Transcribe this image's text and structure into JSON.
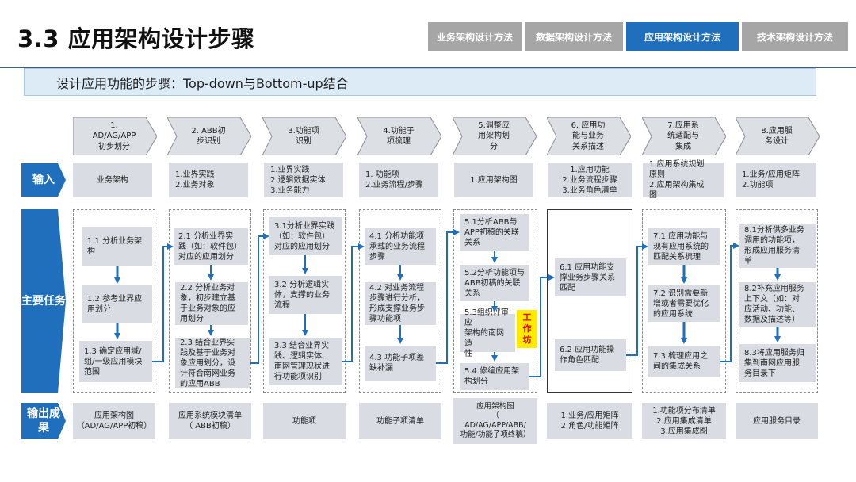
{
  "page_title": "3.3 应用架构设计步骤",
  "nav_tabs": [
    {
      "label": "业务架构设计方法",
      "active": false
    },
    {
      "label": "数据架构设计方法",
      "active": false
    },
    {
      "label": "应用架构设计方法",
      "active": true
    },
    {
      "label": "技术架构设计方法",
      "active": false
    }
  ],
  "subtitle": "设计应用功能的步骤：Top-down与Bottom-up结合",
  "row_labels": {
    "input": "输入",
    "tasks": "主要任务",
    "output": "输出成\n果"
  },
  "steps": [
    "1. AD/AG/APP\n初步划分",
    "2. ABB初\n步识别",
    "3.功能项\n识别",
    "4.功能子\n项梳理",
    "5.调整应\n用架构划\n分",
    "6. 应用功\n能与业务\n关系描述",
    "7.应用系\n统适配与\n集成",
    "8.应用服\n务设计"
  ],
  "inputs": [
    "业务架构",
    "1.业界实践\n2.业务对象",
    "1.业界实践\n2.逻辑数据实体\n3.业务能力",
    "1. 功能项\n2.业务流程/步骤",
    "1.应用架构图",
    "1.应用功能\n2.业务流程步骤\n3.业务角色清单",
    "1.应用系统规划\n原则\n2.应用架构集成\n图",
    "1.业务/应用矩阵\n2.功能项"
  ],
  "tasks": {
    "col1": [
      "1.1 分析业务架\n构",
      "1.2 参考业界应\n用划分",
      "1.3 确定应用域/\n组/一级应用模块\n范围"
    ],
    "col2": [
      "2.1 分析业界实\n践（如：软件包）\n对应的应用划分",
      "2.2 分析业务对\n象，初步建立基\n于业务对象的应\n用划分",
      "2.3 结合业界实\n践及基于业务对\n象应用划分，设\n计符合南网业务\n的应用ABB"
    ],
    "col3": [
      "3.1分析业界实践\n（如：软件包）\n对应的应用划分",
      "3.2 分析逻辑实\n体，支撑的业务\n流程",
      "3.3 结合业界实\n践、逻辑实体、\n南网管理现状进\n行功能项识别"
    ],
    "col4": [
      "4.1 分析功能项\n承载的业务流程\n步骤",
      "4.2 对业务流程\n步骤进行分析，\n形成支撑业务步\n骤功能项",
      "4.3 功能子项差\n缺补漏"
    ],
    "col5": [
      "5.1分析ABB与\nAPP初稿的关联\n关系",
      "5.2分析功能项与\nABB初稿的关联\n关系",
      "5.3组织评审应\n架构的南网适\n性",
      "5.4 修编应用架\n构划分"
    ],
    "col6": [
      "6.1 应用功能支\n撑业务步骤关系\n匹配",
      "6.2 应用功能操\n作角色匹配"
    ],
    "col7": [
      "7.1 应用功能与\n现有应用系统的\n匹配关系梳理",
      "7.2 识别需要新\n增或者需要优化\n的应用系统",
      "7.3 梳理应用之\n间的集成关系"
    ],
    "col8": [
      "8.1分析供多业务\n调用的功能项，\n形成应用服务清\n单",
      "8.2补充应用服务\n上下文（如：对\n应活动、功能、\n数据及描述等）",
      "8.3将应用服务归\n集到南网应用服\n务目录下"
    ]
  },
  "workshop_badge": "工\n作\n坊",
  "outputs": [
    "应用架构图\n（AD/AG/APP初稿）",
    "应用系统模块清单\n（ ABB初稿）",
    "功能项",
    "功能子项清单",
    "应用架构图\n（\nAD/AG/APP/ABB/\n功能/功能子项终稿）",
    "1.业务/应用矩阵\n2.角色/功能矩阵",
    "1.功能项分布清单\n2.应用集成清单\n3.应用集成图",
    "应用服务目录"
  ],
  "colors": {
    "accent_blue": "#1f6fbd",
    "nav_gray": "#a6a6a6",
    "cell_gray": "#d9dde3",
    "subtitle_bg": "#dcebf6",
    "badge_yellow": "#ffeb00",
    "badge_red": "#e60012"
  }
}
